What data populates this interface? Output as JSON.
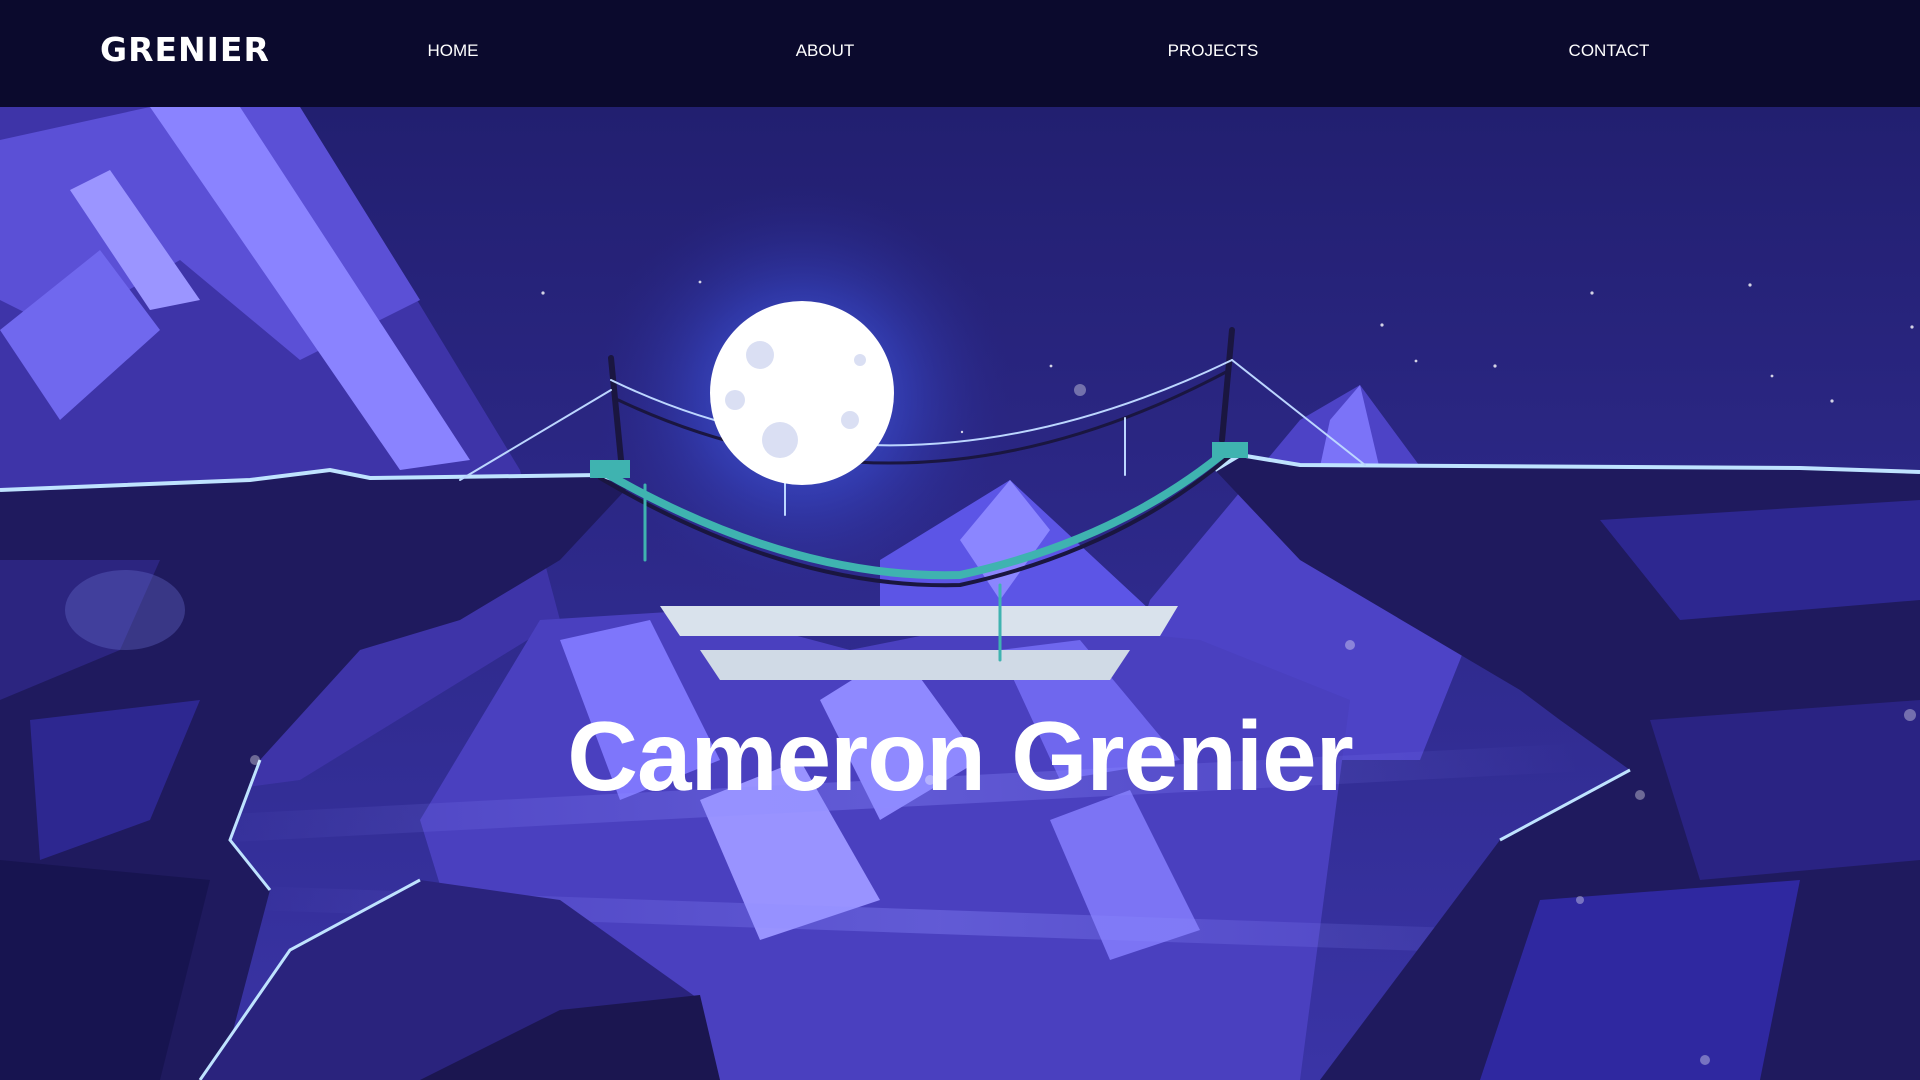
{
  "header": {
    "logo": "GRENIER",
    "nav": {
      "home": "HOME",
      "about": "ABOUT",
      "projects": "PROJECTS",
      "contact": "CONTACT"
    }
  },
  "hero": {
    "title": "Cameron Grenier",
    "background_image": "night-mountains-bridge-moon-illustration"
  },
  "colors": {
    "nav_background": "#0b0a2d",
    "sky": "#272479",
    "mountain_light": "#7a74f5",
    "mountain_mid": "#4a3fb3",
    "mountain_dark": "#1b1650",
    "moon": "#ffffff",
    "accent_teal": "#3fb3b0",
    "text": "#ffffff"
  }
}
